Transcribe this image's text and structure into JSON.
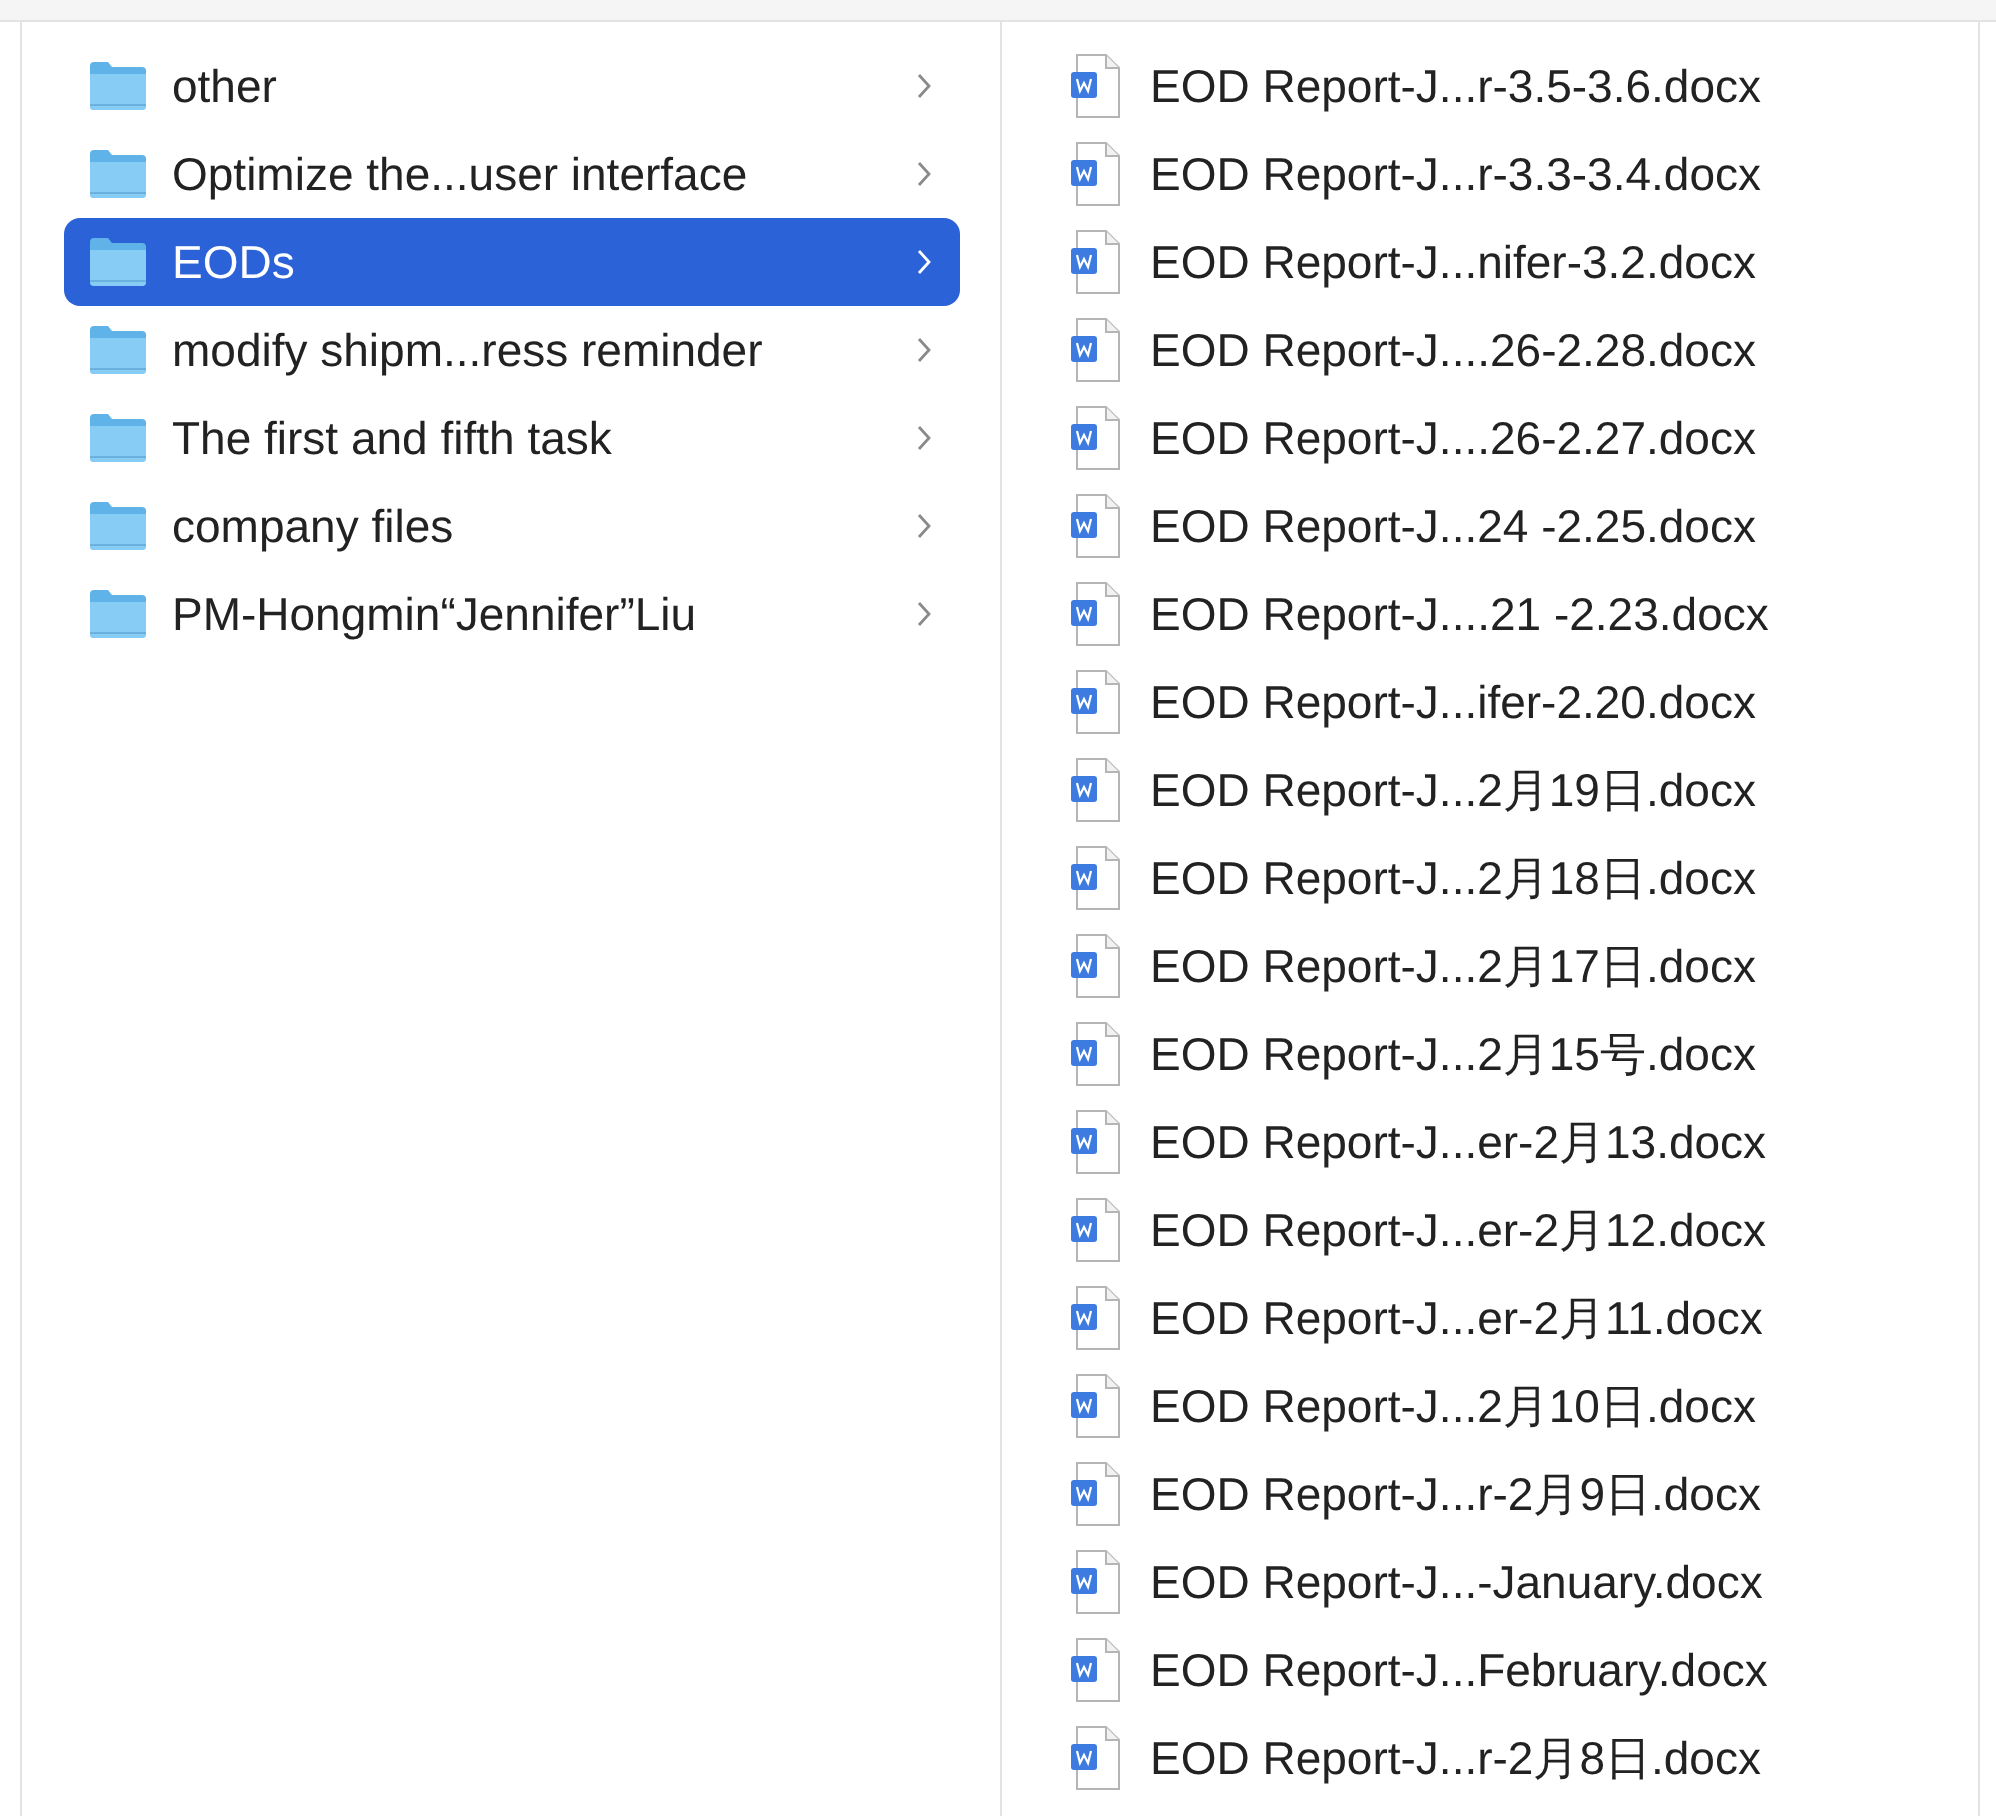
{
  "folders": [
    {
      "name": "other",
      "selected": false
    },
    {
      "name": "Optimize the...user interface",
      "selected": false
    },
    {
      "name": "EODs",
      "selected": true
    },
    {
      "name": "modify shipm...ress reminder",
      "selected": false
    },
    {
      "name": "The first and fifth task",
      "selected": false
    },
    {
      "name": "company files",
      "selected": false
    },
    {
      "name": "PM-Hongmin“Jennifer”Liu",
      "selected": false
    }
  ],
  "files": [
    {
      "name": "EOD Report-J...r-3.5-3.6.docx"
    },
    {
      "name": "EOD Report-J...r-3.3-3.4.docx"
    },
    {
      "name": "EOD Report-J...nifer-3.2.docx"
    },
    {
      "name": "EOD Report-J....26-2.28.docx"
    },
    {
      "name": "EOD Report-J....26-2.27.docx"
    },
    {
      "name": "EOD Report-J...24 -2.25.docx"
    },
    {
      "name": "EOD Report-J....21 -2.23.docx"
    },
    {
      "name": "EOD Report-J...ifer-2.20.docx"
    },
    {
      "name": "EOD Report-J...2月19日.docx"
    },
    {
      "name": "EOD Report-J...2月18日.docx"
    },
    {
      "name": "EOD Report-J...2月17日.docx"
    },
    {
      "name": "EOD Report-J...2月15号.docx"
    },
    {
      "name": "EOD Report-J...er-2月13.docx"
    },
    {
      "name": "EOD Report-J...er-2月12.docx"
    },
    {
      "name": "EOD Report-J...er-2月11.docx"
    },
    {
      "name": "EOD Report-J...2月10日.docx"
    },
    {
      "name": "EOD Report-J...r-2月9日.docx"
    },
    {
      "name": "EOD Report-J...-January.docx"
    },
    {
      "name": "EOD Report-J...February.docx"
    },
    {
      "name": "EOD Report-J...r-2月8日.docx"
    }
  ]
}
